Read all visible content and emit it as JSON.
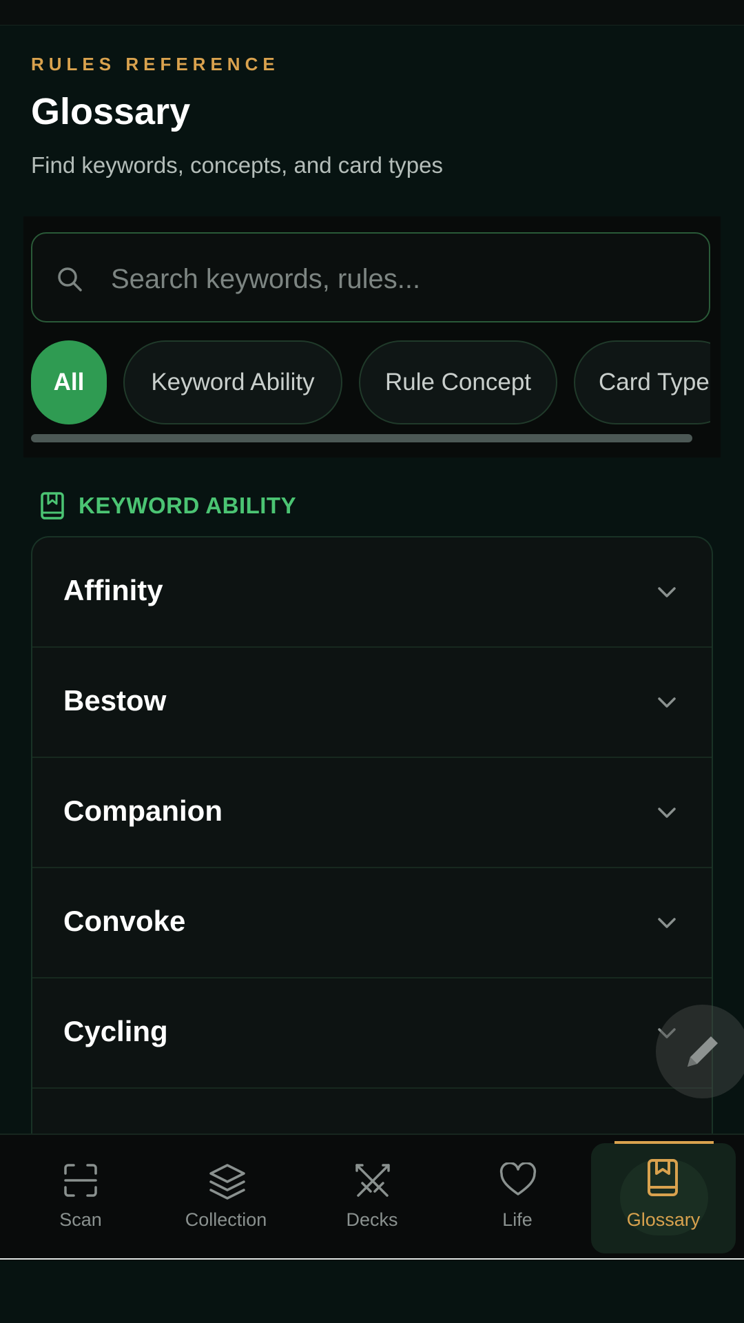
{
  "header": {
    "eyebrow": "RULES REFERENCE",
    "title": "Glossary",
    "subtitle": "Find keywords, concepts, and card types"
  },
  "search": {
    "placeholder": "Search keywords, rules...",
    "value": ""
  },
  "filters": [
    {
      "label": "All",
      "active": true
    },
    {
      "label": "Keyword Ability",
      "active": false
    },
    {
      "label": "Rule Concept",
      "active": false
    },
    {
      "label": "Card Type",
      "active": false
    }
  ],
  "section": {
    "label": "KEYWORD ABILITY",
    "icon": "book-icon"
  },
  "entries": [
    "Affinity",
    "Bestow",
    "Companion",
    "Convoke",
    "Cycling"
  ],
  "fab": {
    "icon": "pencil-icon"
  },
  "nav": [
    {
      "label": "Scan",
      "icon": "scan-icon",
      "active": false
    },
    {
      "label": "Collection",
      "icon": "layers-icon",
      "active": false
    },
    {
      "label": "Decks",
      "icon": "swords-icon",
      "active": false
    },
    {
      "label": "Life",
      "icon": "heart-icon",
      "active": false
    },
    {
      "label": "Glossary",
      "icon": "book-icon",
      "active": true
    }
  ],
  "colors": {
    "accent": "#d9a24e",
    "green": "#2f9b52",
    "section_green": "#4bc473",
    "background": "#071311"
  }
}
